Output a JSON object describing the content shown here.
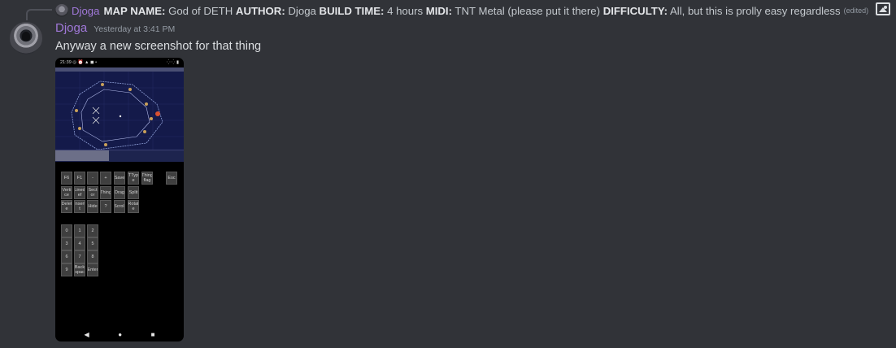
{
  "reply": {
    "author": "Djoga",
    "segments": [
      {
        "label": "MAP NAME:",
        "value": "God of DETH"
      },
      {
        "label": "AUTHOR:",
        "value": "Djoga"
      },
      {
        "label": "BUILD TIME:",
        "value": "4 hours"
      },
      {
        "label": "MIDI:",
        "value": "TNT Metal (please put it there)"
      },
      {
        "label": "DIFFICULTY:",
        "value": "All, but this is prolly easy regardless"
      }
    ],
    "edited": "(edited)",
    "attachment_icon": "image-icon"
  },
  "message": {
    "author": "Djoga",
    "timestamp": "Yesterday at 3:41 PM",
    "text": "Anyway a new screenshot for that thing",
    "author_color": "#a078d8"
  },
  "screenshot": {
    "time": "21:39",
    "status_icons": "◎ ⏰ ▲ ◼ •",
    "status_right": "⁛ ⁛ ▮",
    "keys_row1": [
      "F6",
      "F1",
      "-",
      "+",
      "Save",
      "TTyp e",
      "Thing flag",
      "Esc"
    ],
    "keys_row2": [
      "Verti ce",
      "Lined ef",
      "Sect or",
      "Thing",
      "Drag",
      "Split"
    ],
    "keys_row3": [
      "Delet e",
      "Insert t",
      "Hide",
      "?",
      "Scroll",
      "Rotat e"
    ],
    "numpad": [
      [
        "0",
        "1",
        "2"
      ],
      [
        "3",
        "4",
        "5"
      ],
      [
        "6",
        "7",
        "8"
      ],
      [
        "9",
        "Back spac",
        "Enter"
      ]
    ],
    "nav": [
      "◀",
      "●",
      "■"
    ]
  },
  "colors": {
    "background": "#313338",
    "name": "#a078d8",
    "map_bg": "#141a4a"
  }
}
